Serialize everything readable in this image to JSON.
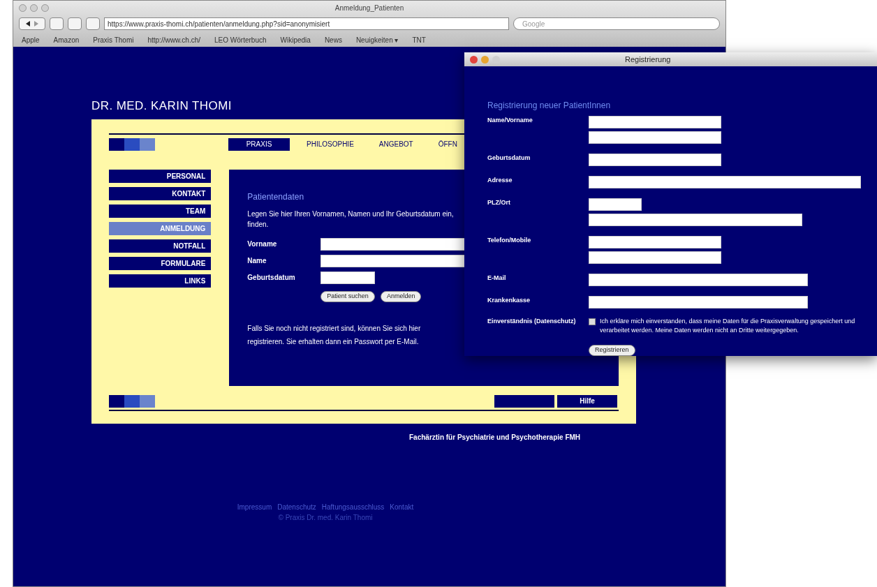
{
  "browser": {
    "title": "Anmeldung_Patienten",
    "url": "https://www.praxis-thomi.ch/patienten/anmeldung.php?sid=anonymisiert",
    "search": {
      "placeholder": "Google"
    },
    "bookmarks": [
      "Apple",
      "Amazon",
      "Praxis Thomi",
      "http://www.ch.ch/",
      "LEO Wörterbuch",
      "Wikipedia",
      "News",
      "Neuigkeiten ▾",
      "TNT"
    ]
  },
  "page": {
    "title": "DR. MED. KARIN THOMI",
    "nav": [
      {
        "label": "PRAXIS",
        "selected": true
      },
      {
        "label": "PHILOSOPHIE",
        "selected": false
      },
      {
        "label": "ANGEBOT",
        "selected": false
      },
      {
        "label": "ÖFFN",
        "selected": false
      }
    ],
    "sidebar": [
      {
        "label": "PERSONAL",
        "selected": false
      },
      {
        "label": "KONTAKT",
        "selected": false
      },
      {
        "label": "TEAM",
        "selected": false
      },
      {
        "label": "ANMELDUNG",
        "selected": true
      },
      {
        "label": "NOTFALL",
        "selected": false
      },
      {
        "label": "FORMULARE",
        "selected": false
      },
      {
        "label": "LINKS",
        "selected": false
      }
    ],
    "content": {
      "heading": "Patientendaten",
      "intro": "Legen Sie hier Ihren Vornamen, Namen und Ihr Geburtsdatum ein,",
      "intro_2": "finden.",
      "fields": [
        {
          "label": "Vorname",
          "kind": "long"
        },
        {
          "label": "Name",
          "kind": "long"
        },
        {
          "label": "Geburtsdatum",
          "kind": "short"
        }
      ],
      "buttons": [
        "Patient suchen",
        "Anmelden"
      ],
      "note": "Falls Sie noch nicht registriert sind, können Sie sich hier",
      "note_2": "registrieren. Sie erhalten dann ein Passwort per E-Mail."
    },
    "bottom_buttons": [
      {
        "selected": false
      },
      {
        "label": "Hilfe",
        "selected": false
      }
    ],
    "footer": "Fachärztin für Psychiatrie und Psychotherapie FMH",
    "links": [
      "Impressum",
      "Datenschutz",
      "Haftungsausschluss",
      "Kontakt"
    ],
    "links_2": "© Praxis Dr. med. Karin Thomi"
  },
  "popup": {
    "title": "Registrierung",
    "heading": "Registrierung neuer PatientInnen",
    "fields": [
      {
        "label": "Name/Vorname",
        "kind": "double"
      },
      {
        "label": "Geburtsdatum",
        "kind": "single"
      },
      {
        "label": "Adresse",
        "kind": "wide"
      },
      {
        "label": "PLZ/Ort",
        "kind": "zip_city"
      },
      {
        "label": "Telefon/Mobile",
        "kind": "double"
      },
      {
        "label": "E-Mail",
        "kind": "long"
      },
      {
        "label": "Krankenkasse",
        "kind": "long"
      }
    ],
    "consent": {
      "label": "Einverständnis (Datenschutz)",
      "checked": false,
      "text": "Ich erkläre mich einverstanden, dass meine Daten für die Praxisverwaltung gespeichert und verarbeitet werden. Meine Daten werden nicht an Dritte weitergegeben."
    },
    "button": "Registrieren"
  }
}
